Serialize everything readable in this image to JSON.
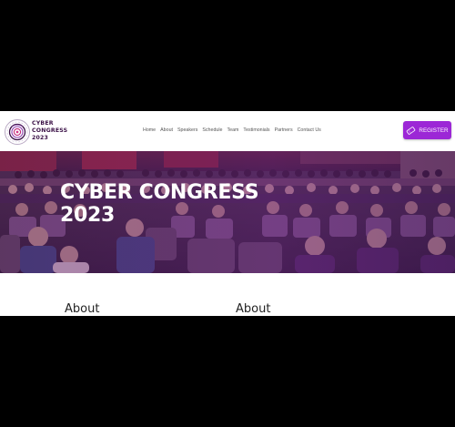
{
  "brand": {
    "line1": "CYBER",
    "line2": "CONGRESS",
    "line3": "2023",
    "logo_icon": "fingerprint-target-logo",
    "color": "#3a1046"
  },
  "nav": {
    "items": [
      "Home",
      "About",
      "Speakers",
      "Schedule",
      "Team",
      "Testimonials",
      "Partners",
      "Contact Us"
    ]
  },
  "register": {
    "label": "REGISTER",
    "icon": "ticket-icon",
    "color": "#9c27d6"
  },
  "hero": {
    "title_line1": "CYBER CONGRESS",
    "title_line2": "2023",
    "overlay_color": "#6e1e8c"
  },
  "sections": {
    "left_heading": "About",
    "right_heading": "About"
  }
}
